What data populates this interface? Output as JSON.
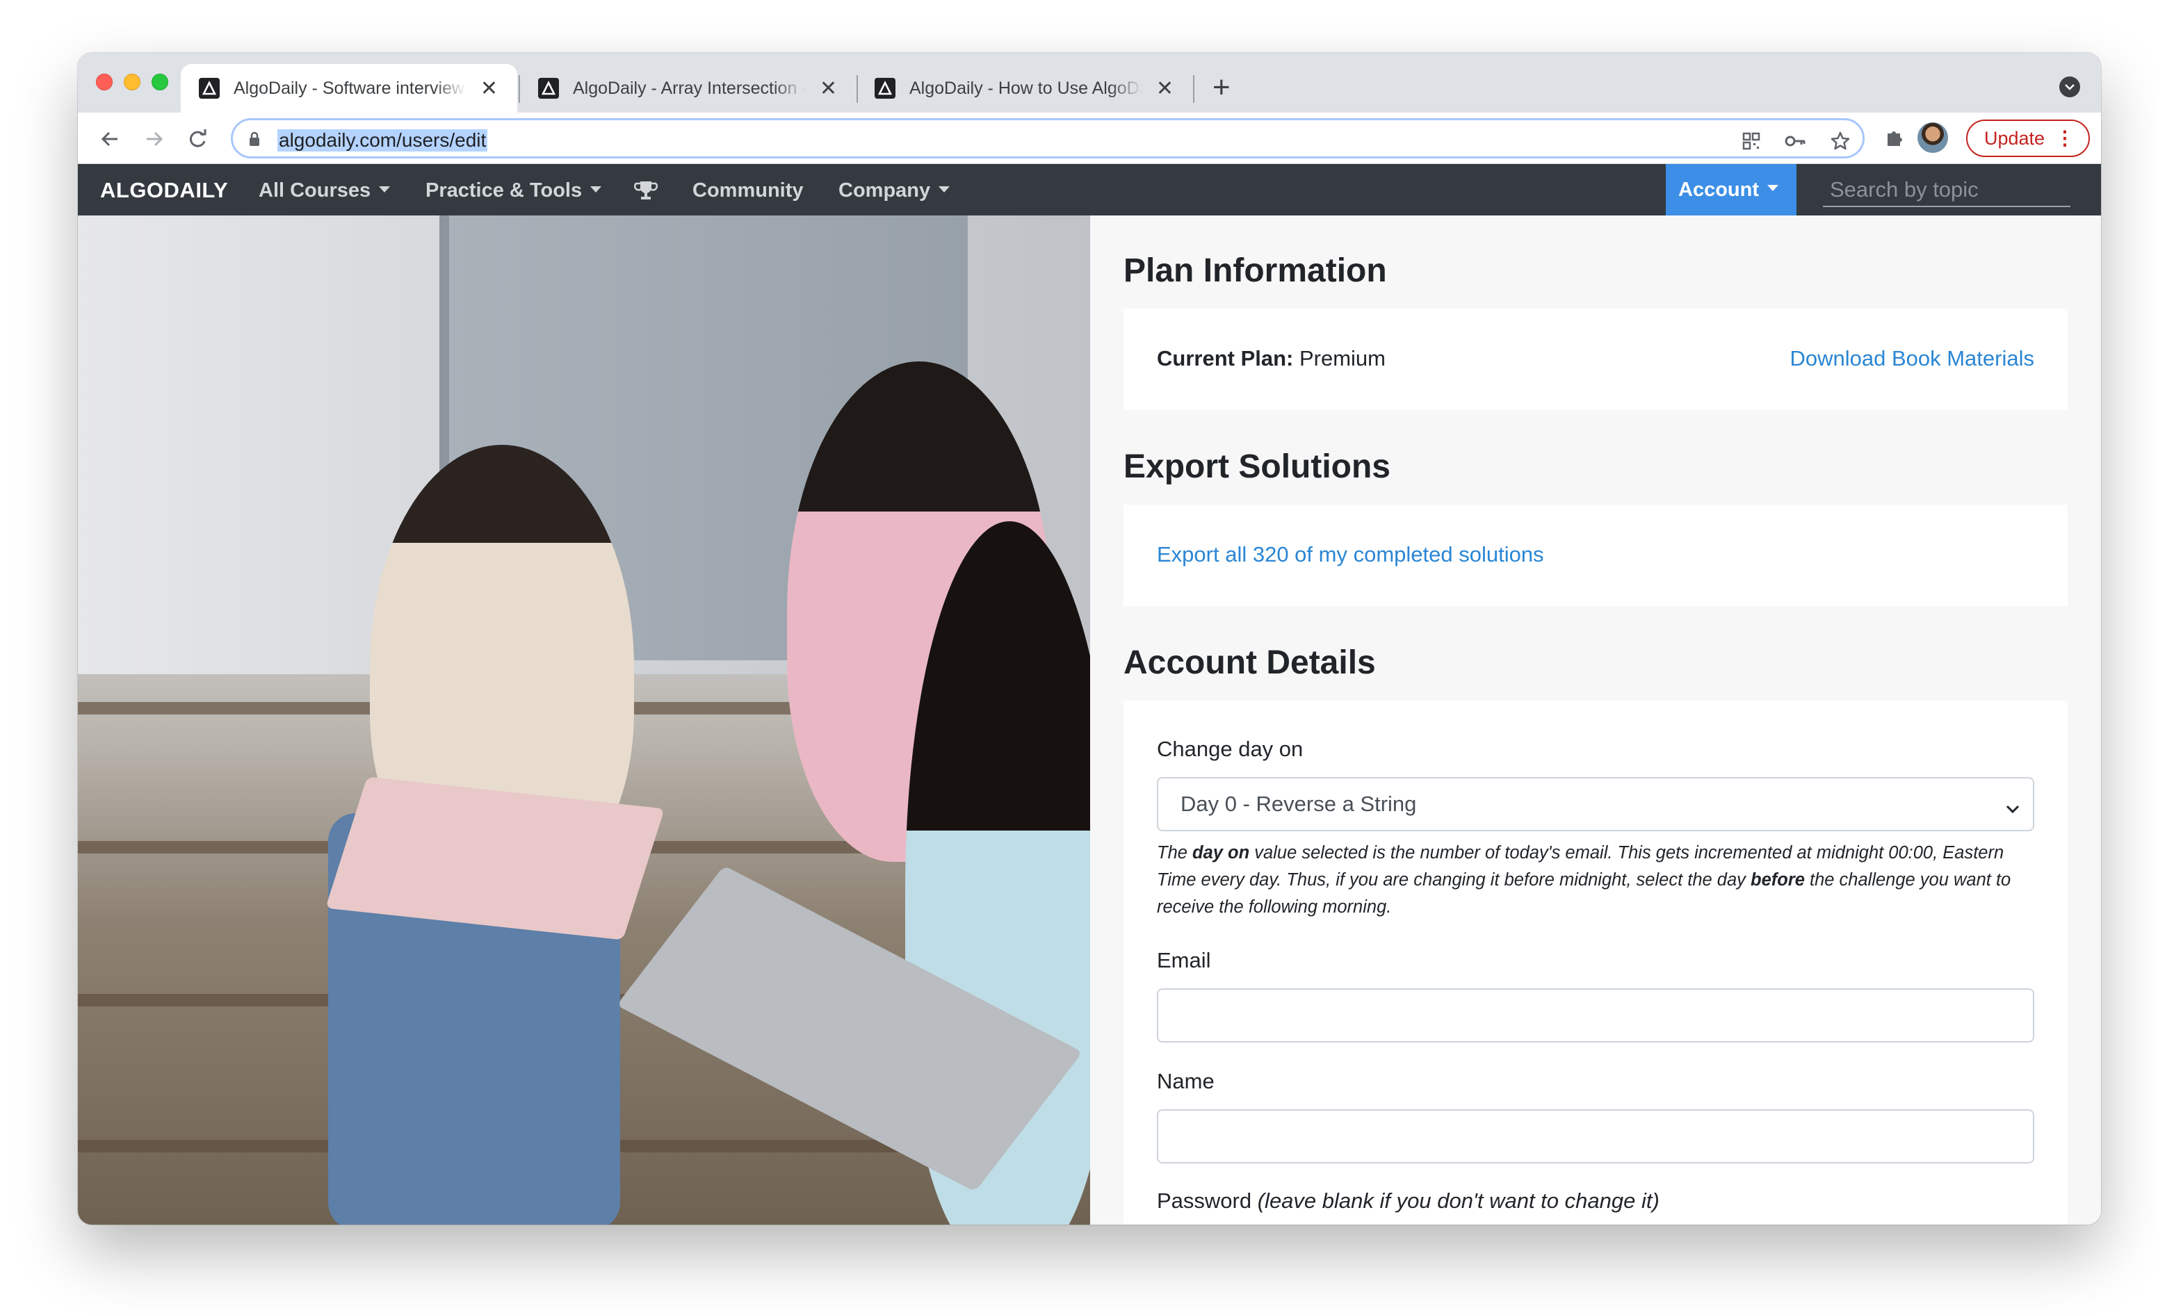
{
  "browser": {
    "tabs": [
      {
        "title": "AlgoDaily - Software interview prep made easy"
      },
      {
        "title": "AlgoDaily - Array Intersection - Description"
      },
      {
        "title": "AlgoDaily - How to Use AlgoDaily"
      }
    ],
    "url": "algodaily.com/users/edit",
    "update_label": "Update",
    "icons": [
      "back-arrow-icon",
      "forward-arrow-icon",
      "reload-icon",
      "lock-icon",
      "qr-code-icon",
      "key-icon",
      "star-icon",
      "puzzle-icon",
      "close-icon",
      "plus-icon",
      "tab-search-icon"
    ]
  },
  "nav": {
    "brand": "ALGODAILY",
    "items": [
      "All Courses",
      "Practice & Tools",
      "Community",
      "Company"
    ],
    "account": "Account",
    "search_placeholder": "Search by topic",
    "accent": "#3c8ee6",
    "bar_color": "#343a40"
  },
  "plan": {
    "title": "Plan Information",
    "current_label": "Current Plan:",
    "current_value": "Premium",
    "download_link": "Download Book Materials"
  },
  "export": {
    "title": "Export Solutions",
    "link": "Export all 320 of my completed solutions"
  },
  "account": {
    "title": "Account Details",
    "day_label": "Change day on",
    "day_value": "Day 0 - Reverse a String",
    "help_pre": "The ",
    "help_bold1": "day on",
    "help_mid": " value selected is the number of today's email. This gets incremented at midnight 00:00, Eastern Time every day. Thus, if you are changing it before midnight, select the day ",
    "help_bold2": "before",
    "help_post": " the challenge you want to receive the following morning.",
    "email_label": "Email",
    "email_value": "",
    "name_label": "Name",
    "name_value": "",
    "password_label": "Password",
    "password_hint": "(leave blank if you don't want to change it)"
  },
  "colors": {
    "link": "#2a86d4",
    "update": "#c5221f"
  }
}
